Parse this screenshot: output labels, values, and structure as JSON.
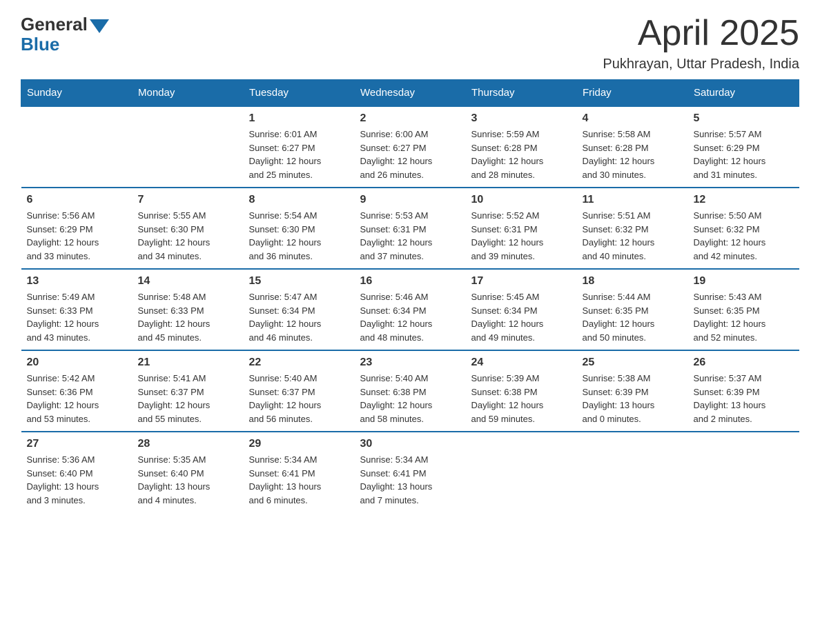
{
  "logo": {
    "general": "General",
    "blue": "Blue"
  },
  "header": {
    "month_title": "April 2025",
    "location": "Pukhrayan, Uttar Pradesh, India"
  },
  "days_of_week": [
    "Sunday",
    "Monday",
    "Tuesday",
    "Wednesday",
    "Thursday",
    "Friday",
    "Saturday"
  ],
  "weeks": [
    [
      {
        "day": "",
        "info": ""
      },
      {
        "day": "",
        "info": ""
      },
      {
        "day": "1",
        "info": "Sunrise: 6:01 AM\nSunset: 6:27 PM\nDaylight: 12 hours\nand 25 minutes."
      },
      {
        "day": "2",
        "info": "Sunrise: 6:00 AM\nSunset: 6:27 PM\nDaylight: 12 hours\nand 26 minutes."
      },
      {
        "day": "3",
        "info": "Sunrise: 5:59 AM\nSunset: 6:28 PM\nDaylight: 12 hours\nand 28 minutes."
      },
      {
        "day": "4",
        "info": "Sunrise: 5:58 AM\nSunset: 6:28 PM\nDaylight: 12 hours\nand 30 minutes."
      },
      {
        "day": "5",
        "info": "Sunrise: 5:57 AM\nSunset: 6:29 PM\nDaylight: 12 hours\nand 31 minutes."
      }
    ],
    [
      {
        "day": "6",
        "info": "Sunrise: 5:56 AM\nSunset: 6:29 PM\nDaylight: 12 hours\nand 33 minutes."
      },
      {
        "day": "7",
        "info": "Sunrise: 5:55 AM\nSunset: 6:30 PM\nDaylight: 12 hours\nand 34 minutes."
      },
      {
        "day": "8",
        "info": "Sunrise: 5:54 AM\nSunset: 6:30 PM\nDaylight: 12 hours\nand 36 minutes."
      },
      {
        "day": "9",
        "info": "Sunrise: 5:53 AM\nSunset: 6:31 PM\nDaylight: 12 hours\nand 37 minutes."
      },
      {
        "day": "10",
        "info": "Sunrise: 5:52 AM\nSunset: 6:31 PM\nDaylight: 12 hours\nand 39 minutes."
      },
      {
        "day": "11",
        "info": "Sunrise: 5:51 AM\nSunset: 6:32 PM\nDaylight: 12 hours\nand 40 minutes."
      },
      {
        "day": "12",
        "info": "Sunrise: 5:50 AM\nSunset: 6:32 PM\nDaylight: 12 hours\nand 42 minutes."
      }
    ],
    [
      {
        "day": "13",
        "info": "Sunrise: 5:49 AM\nSunset: 6:33 PM\nDaylight: 12 hours\nand 43 minutes."
      },
      {
        "day": "14",
        "info": "Sunrise: 5:48 AM\nSunset: 6:33 PM\nDaylight: 12 hours\nand 45 minutes."
      },
      {
        "day": "15",
        "info": "Sunrise: 5:47 AM\nSunset: 6:34 PM\nDaylight: 12 hours\nand 46 minutes."
      },
      {
        "day": "16",
        "info": "Sunrise: 5:46 AM\nSunset: 6:34 PM\nDaylight: 12 hours\nand 48 minutes."
      },
      {
        "day": "17",
        "info": "Sunrise: 5:45 AM\nSunset: 6:34 PM\nDaylight: 12 hours\nand 49 minutes."
      },
      {
        "day": "18",
        "info": "Sunrise: 5:44 AM\nSunset: 6:35 PM\nDaylight: 12 hours\nand 50 minutes."
      },
      {
        "day": "19",
        "info": "Sunrise: 5:43 AM\nSunset: 6:35 PM\nDaylight: 12 hours\nand 52 minutes."
      }
    ],
    [
      {
        "day": "20",
        "info": "Sunrise: 5:42 AM\nSunset: 6:36 PM\nDaylight: 12 hours\nand 53 minutes."
      },
      {
        "day": "21",
        "info": "Sunrise: 5:41 AM\nSunset: 6:37 PM\nDaylight: 12 hours\nand 55 minutes."
      },
      {
        "day": "22",
        "info": "Sunrise: 5:40 AM\nSunset: 6:37 PM\nDaylight: 12 hours\nand 56 minutes."
      },
      {
        "day": "23",
        "info": "Sunrise: 5:40 AM\nSunset: 6:38 PM\nDaylight: 12 hours\nand 58 minutes."
      },
      {
        "day": "24",
        "info": "Sunrise: 5:39 AM\nSunset: 6:38 PM\nDaylight: 12 hours\nand 59 minutes."
      },
      {
        "day": "25",
        "info": "Sunrise: 5:38 AM\nSunset: 6:39 PM\nDaylight: 13 hours\nand 0 minutes."
      },
      {
        "day": "26",
        "info": "Sunrise: 5:37 AM\nSunset: 6:39 PM\nDaylight: 13 hours\nand 2 minutes."
      }
    ],
    [
      {
        "day": "27",
        "info": "Sunrise: 5:36 AM\nSunset: 6:40 PM\nDaylight: 13 hours\nand 3 minutes."
      },
      {
        "day": "28",
        "info": "Sunrise: 5:35 AM\nSunset: 6:40 PM\nDaylight: 13 hours\nand 4 minutes."
      },
      {
        "day": "29",
        "info": "Sunrise: 5:34 AM\nSunset: 6:41 PM\nDaylight: 13 hours\nand 6 minutes."
      },
      {
        "day": "30",
        "info": "Sunrise: 5:34 AM\nSunset: 6:41 PM\nDaylight: 13 hours\nand 7 minutes."
      },
      {
        "day": "",
        "info": ""
      },
      {
        "day": "",
        "info": ""
      },
      {
        "day": "",
        "info": ""
      }
    ]
  ]
}
